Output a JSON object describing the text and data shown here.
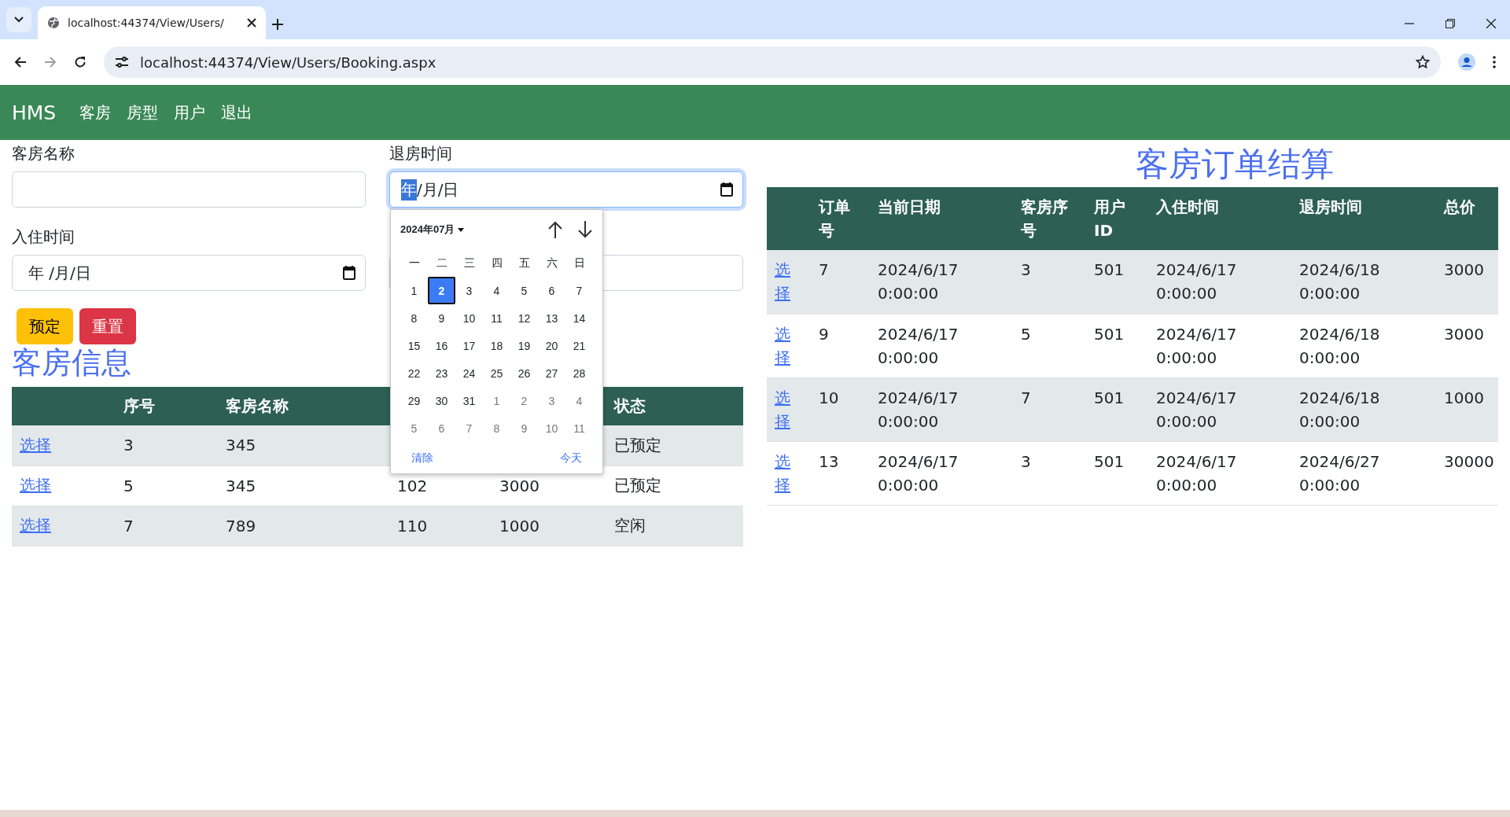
{
  "browser": {
    "tab_title": "localhost:44374/View/Users/",
    "address": "localhost:44374/View/Users/Booking.aspx"
  },
  "navbar": {
    "brand": "HMS",
    "items": [
      "客房",
      "房型",
      "用户",
      "退出"
    ]
  },
  "form": {
    "fields": [
      {
        "kind": "text",
        "label": "客房名称",
        "focused": false
      },
      {
        "kind": "date",
        "label": "退房时间",
        "parts": [
          "年",
          "/月/日"
        ],
        "focused": true
      },
      {
        "kind": "date",
        "label": "入住时间",
        "parts": [
          "年",
          " /月/日"
        ],
        "focused": false
      },
      {
        "kind": "blank",
        "focused": false
      }
    ],
    "buttons": [
      {
        "label": "预定",
        "kind": "warning"
      },
      {
        "label": "重置",
        "kind": "danger"
      }
    ]
  },
  "rooms": {
    "title": "客房信息",
    "columns": [
      "",
      "序号",
      "客房名称",
      null,
      null,
      "状态"
    ],
    "rows": [
      {
        "cells": [
          "选择",
          "3",
          "345",
          null,
          null,
          "已预定"
        ]
      },
      {
        "cells": [
          "选择",
          "5",
          "345",
          "102",
          "3000",
          "已预定"
        ]
      },
      {
        "cells": [
          "选择",
          "7",
          "789",
          "110",
          "1000",
          "空闲"
        ]
      }
    ]
  },
  "orders": {
    "title": "客房订单结算",
    "columns": [
      "",
      "订单号",
      "当前日期",
      "客房序号",
      "用户ID",
      "入住时间",
      "退房时间",
      "总价"
    ],
    "rows": [
      {
        "cells": [
          "选择",
          "7",
          "2024/6/17 0:00:00",
          "3",
          "501",
          "2024/6/17 0:00:00",
          "2024/6/18 0:00:00",
          "3000"
        ]
      },
      {
        "cells": [
          "选择",
          "9",
          "2024/6/17 0:00:00",
          "5",
          "501",
          "2024/6/17 0:00:00",
          "2024/6/18 0:00:00",
          "3000"
        ]
      },
      {
        "cells": [
          "选择",
          "10",
          "2024/6/17 0:00:00",
          "7",
          "501",
          "2024/6/17 0:00:00",
          "2024/6/18 0:00:00",
          "1000"
        ]
      },
      {
        "cells": [
          "选择",
          "13",
          "2024/6/17 0:00:00",
          "3",
          "501",
          "2024/6/17 0:00:00",
          "2024/6/27 0:00:00",
          "30000"
        ]
      }
    ]
  },
  "calendar": {
    "month": "2024年07月",
    "weekdays": [
      "一",
      "二",
      "三",
      "四",
      "五",
      "六",
      "日"
    ],
    "days": [
      {
        "d": "1",
        "outside": false,
        "selected": false
      },
      {
        "d": "2",
        "outside": false,
        "selected": true
      },
      {
        "d": "3",
        "outside": false,
        "selected": false
      },
      {
        "d": "4",
        "outside": false,
        "selected": false
      },
      {
        "d": "5",
        "outside": false,
        "selected": false
      },
      {
        "d": "6",
        "outside": false,
        "selected": false
      },
      {
        "d": "7",
        "outside": false,
        "selected": false
      },
      {
        "d": "8",
        "outside": false,
        "selected": false
      },
      {
        "d": "9",
        "outside": false,
        "selected": false
      },
      {
        "d": "10",
        "outside": false,
        "selected": false
      },
      {
        "d": "11",
        "outside": false,
        "selected": false
      },
      {
        "d": "12",
        "outside": false,
        "selected": false
      },
      {
        "d": "13",
        "outside": false,
        "selected": false
      },
      {
        "d": "14",
        "outside": false,
        "selected": false
      },
      {
        "d": "15",
        "outside": false,
        "selected": false
      },
      {
        "d": "16",
        "outside": false,
        "selected": false
      },
      {
        "d": "17",
        "outside": false,
        "selected": false
      },
      {
        "d": "18",
        "outside": false,
        "selected": false
      },
      {
        "d": "19",
        "outside": false,
        "selected": false
      },
      {
        "d": "20",
        "outside": false,
        "selected": false
      },
      {
        "d": "21",
        "outside": false,
        "selected": false
      },
      {
        "d": "22",
        "outside": false,
        "selected": false
      },
      {
        "d": "23",
        "outside": false,
        "selected": false
      },
      {
        "d": "24",
        "outside": false,
        "selected": false
      },
      {
        "d": "25",
        "outside": false,
        "selected": false
      },
      {
        "d": "26",
        "outside": false,
        "selected": false
      },
      {
        "d": "27",
        "outside": false,
        "selected": false
      },
      {
        "d": "28",
        "outside": false,
        "selected": false
      },
      {
        "d": "29",
        "outside": false,
        "selected": false
      },
      {
        "d": "30",
        "outside": false,
        "selected": false
      },
      {
        "d": "31",
        "outside": false,
        "selected": false
      },
      {
        "d": "1",
        "outside": true,
        "selected": false
      },
      {
        "d": "2",
        "outside": true,
        "selected": false
      },
      {
        "d": "3",
        "outside": true,
        "selected": false
      },
      {
        "d": "4",
        "outside": true,
        "selected": false
      },
      {
        "d": "5",
        "outside": true,
        "selected": false
      },
      {
        "d": "6",
        "outside": true,
        "selected": false
      },
      {
        "d": "7",
        "outside": true,
        "selected": false
      },
      {
        "d": "8",
        "outside": true,
        "selected": false
      },
      {
        "d": "9",
        "outside": true,
        "selected": false
      },
      {
        "d": "10",
        "outside": true,
        "selected": false
      },
      {
        "d": "11",
        "outside": true,
        "selected": false
      }
    ],
    "footer": [
      "清除",
      "今天"
    ]
  }
}
